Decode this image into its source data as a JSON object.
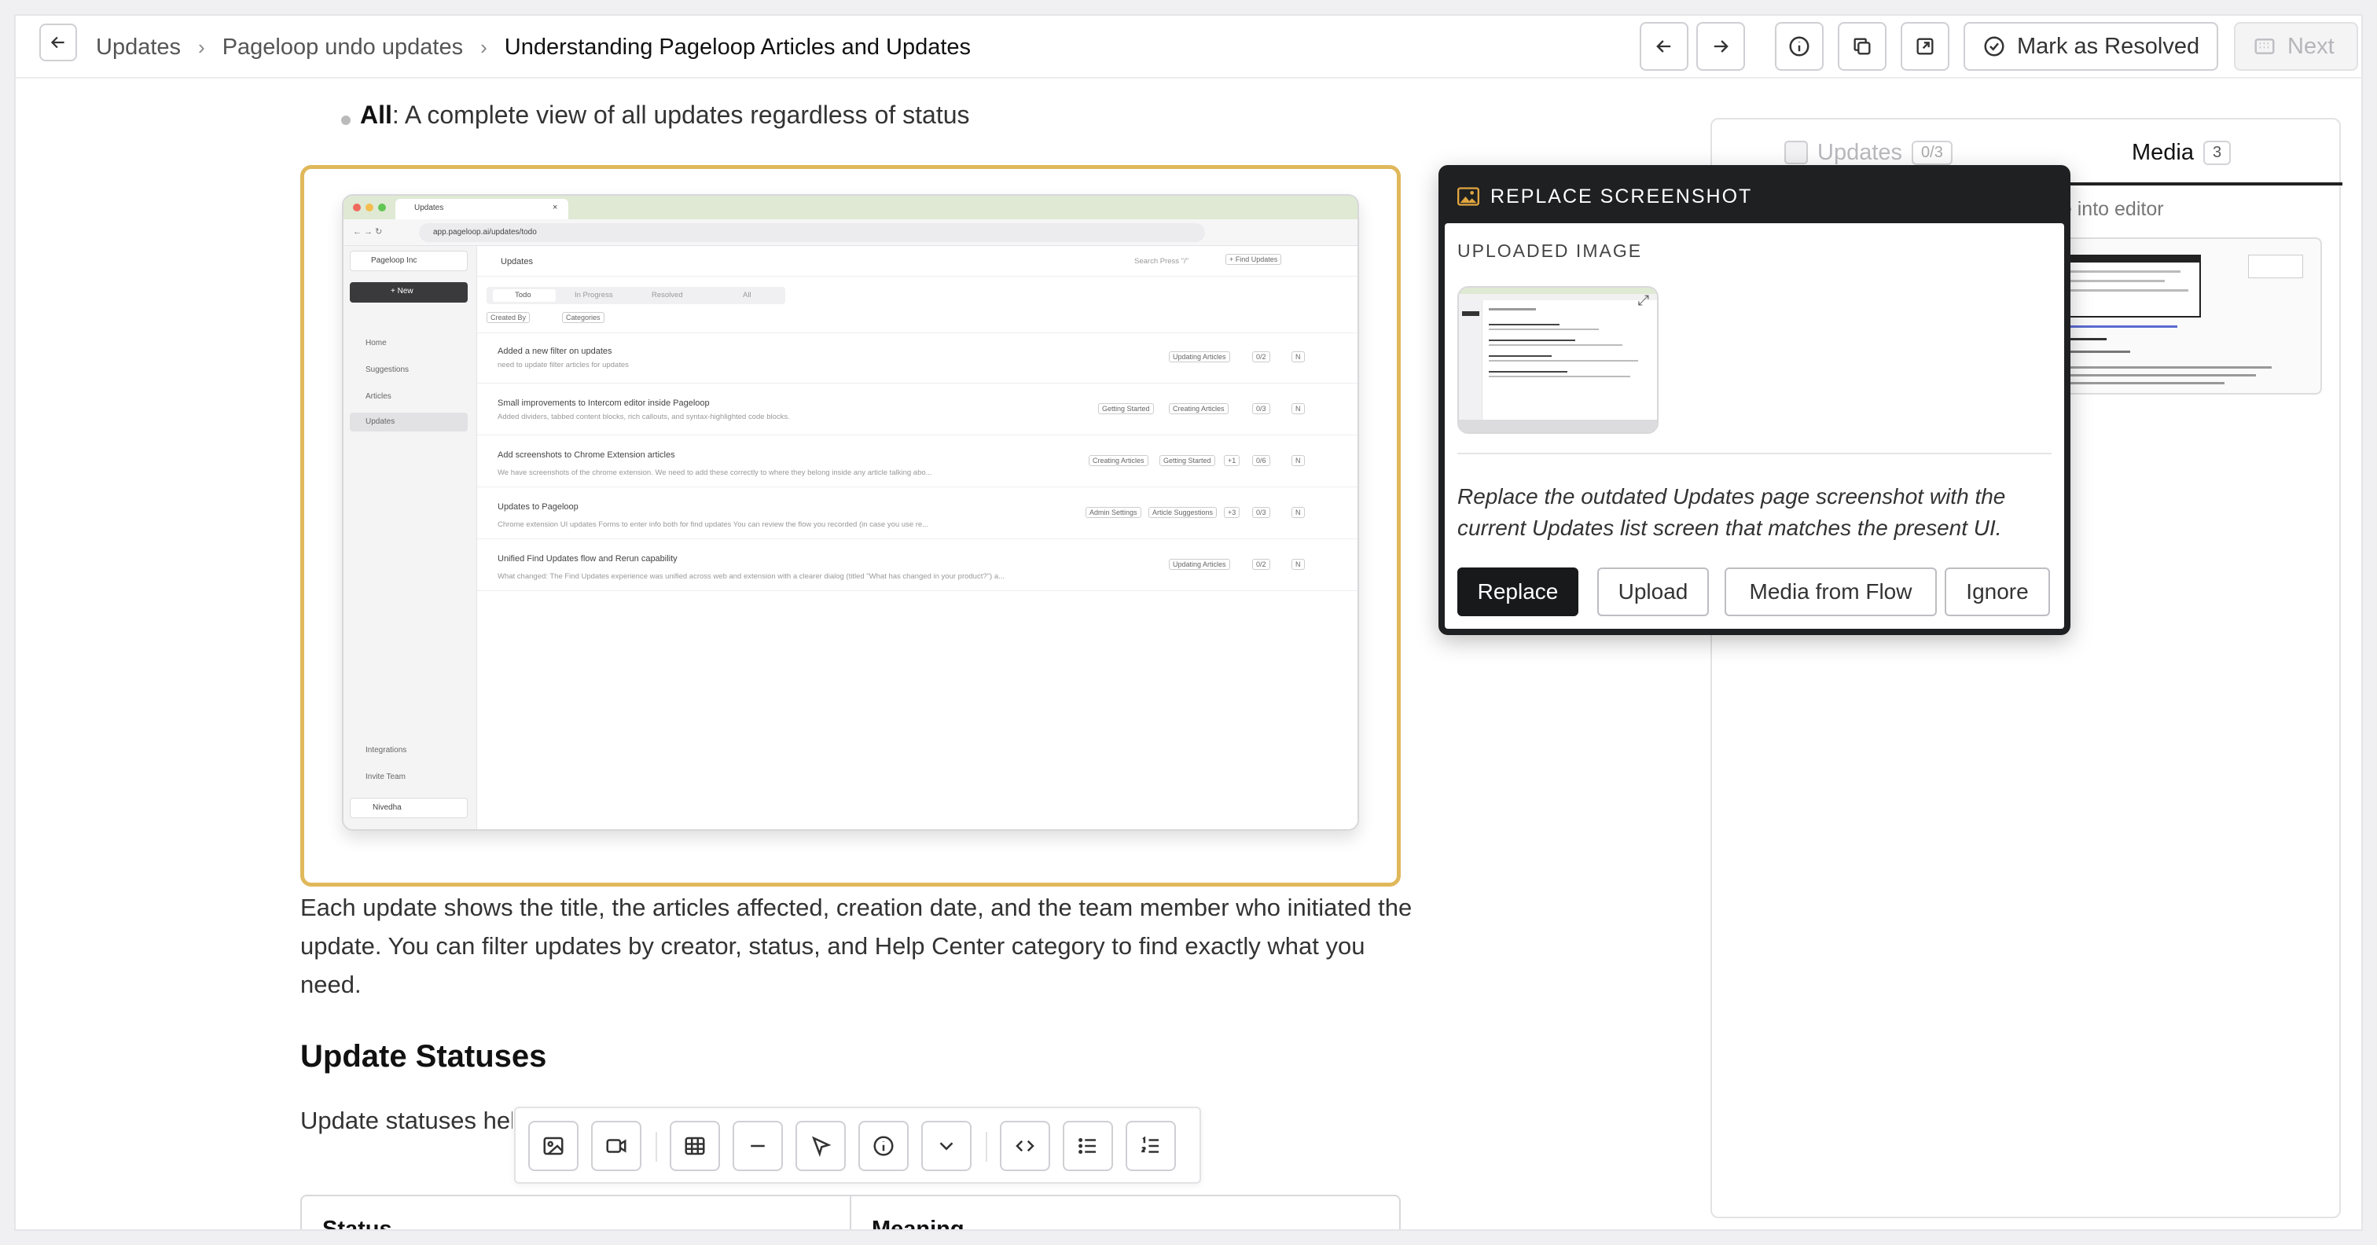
{
  "topbar": {
    "breadcrumbs": [
      "Updates",
      "Pageloop undo updates",
      "Understanding Pageloop Articles and Updates"
    ],
    "mark_resolved": "Mark as Resolved",
    "next": "Next"
  },
  "content": {
    "bullet_bold": "All",
    "bullet_text": ": A complete view of all updates regardless of status",
    "paragraph": "Each update shows the title, the articles affected, creation date, and the team member who initiated the update. You can filter updates by creator, status, and Help Center category to find exactly what you need.",
    "heading": "Update Statuses",
    "partial_text": "Update statuses help",
    "table_headers": [
      "Status",
      "Meaning"
    ]
  },
  "screenshot": {
    "tab_title": "Updates",
    "url": "app.pageloop.ai/updates/todo",
    "workspace": "Pageloop Inc",
    "new_button": "+ New",
    "nav": [
      "Home",
      "Suggestions",
      "Articles",
      "Updates"
    ],
    "footer_nav": [
      "Integrations",
      "Invite Team"
    ],
    "user": "Nivedha",
    "page_title": "Updates",
    "search": "Search Press \"/\"",
    "find_updates": "+ Find Updates",
    "tabs": [
      "Todo",
      "In Progress",
      "Resolved",
      "All"
    ],
    "filters": [
      "Created By",
      "Categories"
    ],
    "rows": [
      {
        "title": "Added a new filter on updates",
        "sub": "need to update filter articles for updates",
        "tags": [
          "Updating Articles"
        ],
        "count": "0/2"
      },
      {
        "title": "Small improvements to Intercom editor inside Pageloop",
        "sub": "Added dividers, tabbed content blocks, rich callouts, and syntax-highlighted code blocks.",
        "tags": [
          "Getting Started",
          "Creating Articles"
        ],
        "count": "0/3"
      },
      {
        "title": "Add screenshots to Chrome Extension articles",
        "sub": "We have screenshots of the chrome extension. We need to add these correctly to where they belong inside any article talking abo...",
        "tags": [
          "Creating Articles",
          "Getting Started",
          "+1"
        ],
        "count": "0/6"
      },
      {
        "title": "Updates to Pageloop",
        "sub": "Chrome extension UI updates Forms to enter info both for find updates You can review the flow you recorded (in case you use re...",
        "tags": [
          "Admin Settings",
          "Article Suggestions",
          "+3"
        ],
        "count": "0/3"
      },
      {
        "title": "Unified Find Updates flow and Rerun capability",
        "sub": "What changed: The Find Updates experience was unified across web and extension with a clearer dialog (titled \"What has changed in your product?\") a...",
        "tags": [
          "Updating Articles"
        ],
        "count": "0/2"
      }
    ],
    "avatar": "N"
  },
  "right_panel": {
    "tabs": [
      {
        "label": "Updates",
        "badge": "0/3"
      },
      {
        "label": "Media",
        "badge": "3"
      }
    ],
    "hint": "ge into editor"
  },
  "popover": {
    "title": "REPLACE SCREENSHOT",
    "label": "UPLOADED IMAGE",
    "description": "Replace the outdated Updates page screenshot with the current Updates list screen that matches the present UI.",
    "buttons": [
      "Replace",
      "Upload",
      "Media from Flow",
      "Ignore"
    ]
  },
  "colors": {
    "highlight_border": "#e0b85b",
    "popover_bg": "#1f2022",
    "primary_button": "#18191b"
  }
}
